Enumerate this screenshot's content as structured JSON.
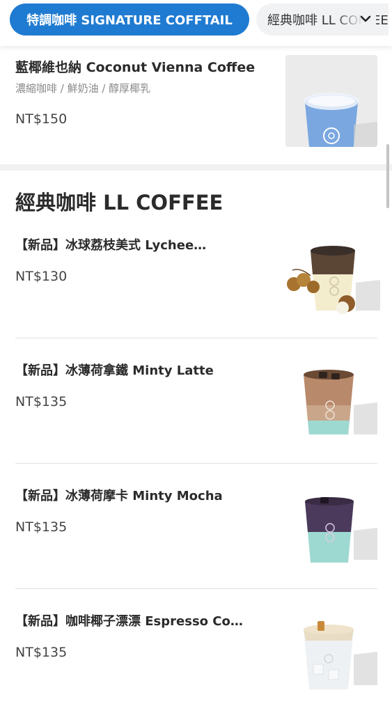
{
  "tabs": {
    "active_label": "特調咖啡 SIGNATURE COFFTAIL",
    "inactive_label": "經典咖啡 LL COFFEE"
  },
  "featured": {
    "name": "藍椰維也納 Coconut Vienna Coffee",
    "description": "濃縮咖啡 / 鮮奶油 / 醇厚椰乳",
    "price": "NT$150"
  },
  "section": {
    "title": "經典咖啡 LL COFFEE"
  },
  "items": [
    {
      "name": "【新品】冰球荔枝美式 Lychee…",
      "price": "NT$130"
    },
    {
      "name": "【新品】冰薄荷拿鐵 Minty Latte",
      "price": "NT$135"
    },
    {
      "name": "【新品】冰薄荷摩卡 Minty Mocha",
      "price": "NT$135"
    },
    {
      "name": "【新品】咖啡椰子漂漂 Espresso Co…",
      "price": "NT$135"
    }
  ],
  "colors": {
    "accent": "#1f7bd1",
    "tab_inactive_bg": "#f1f2f4",
    "coconut_cup": "#7aa7e0",
    "mint": "#9ed9d1",
    "mocha": "#4b3a5c"
  }
}
